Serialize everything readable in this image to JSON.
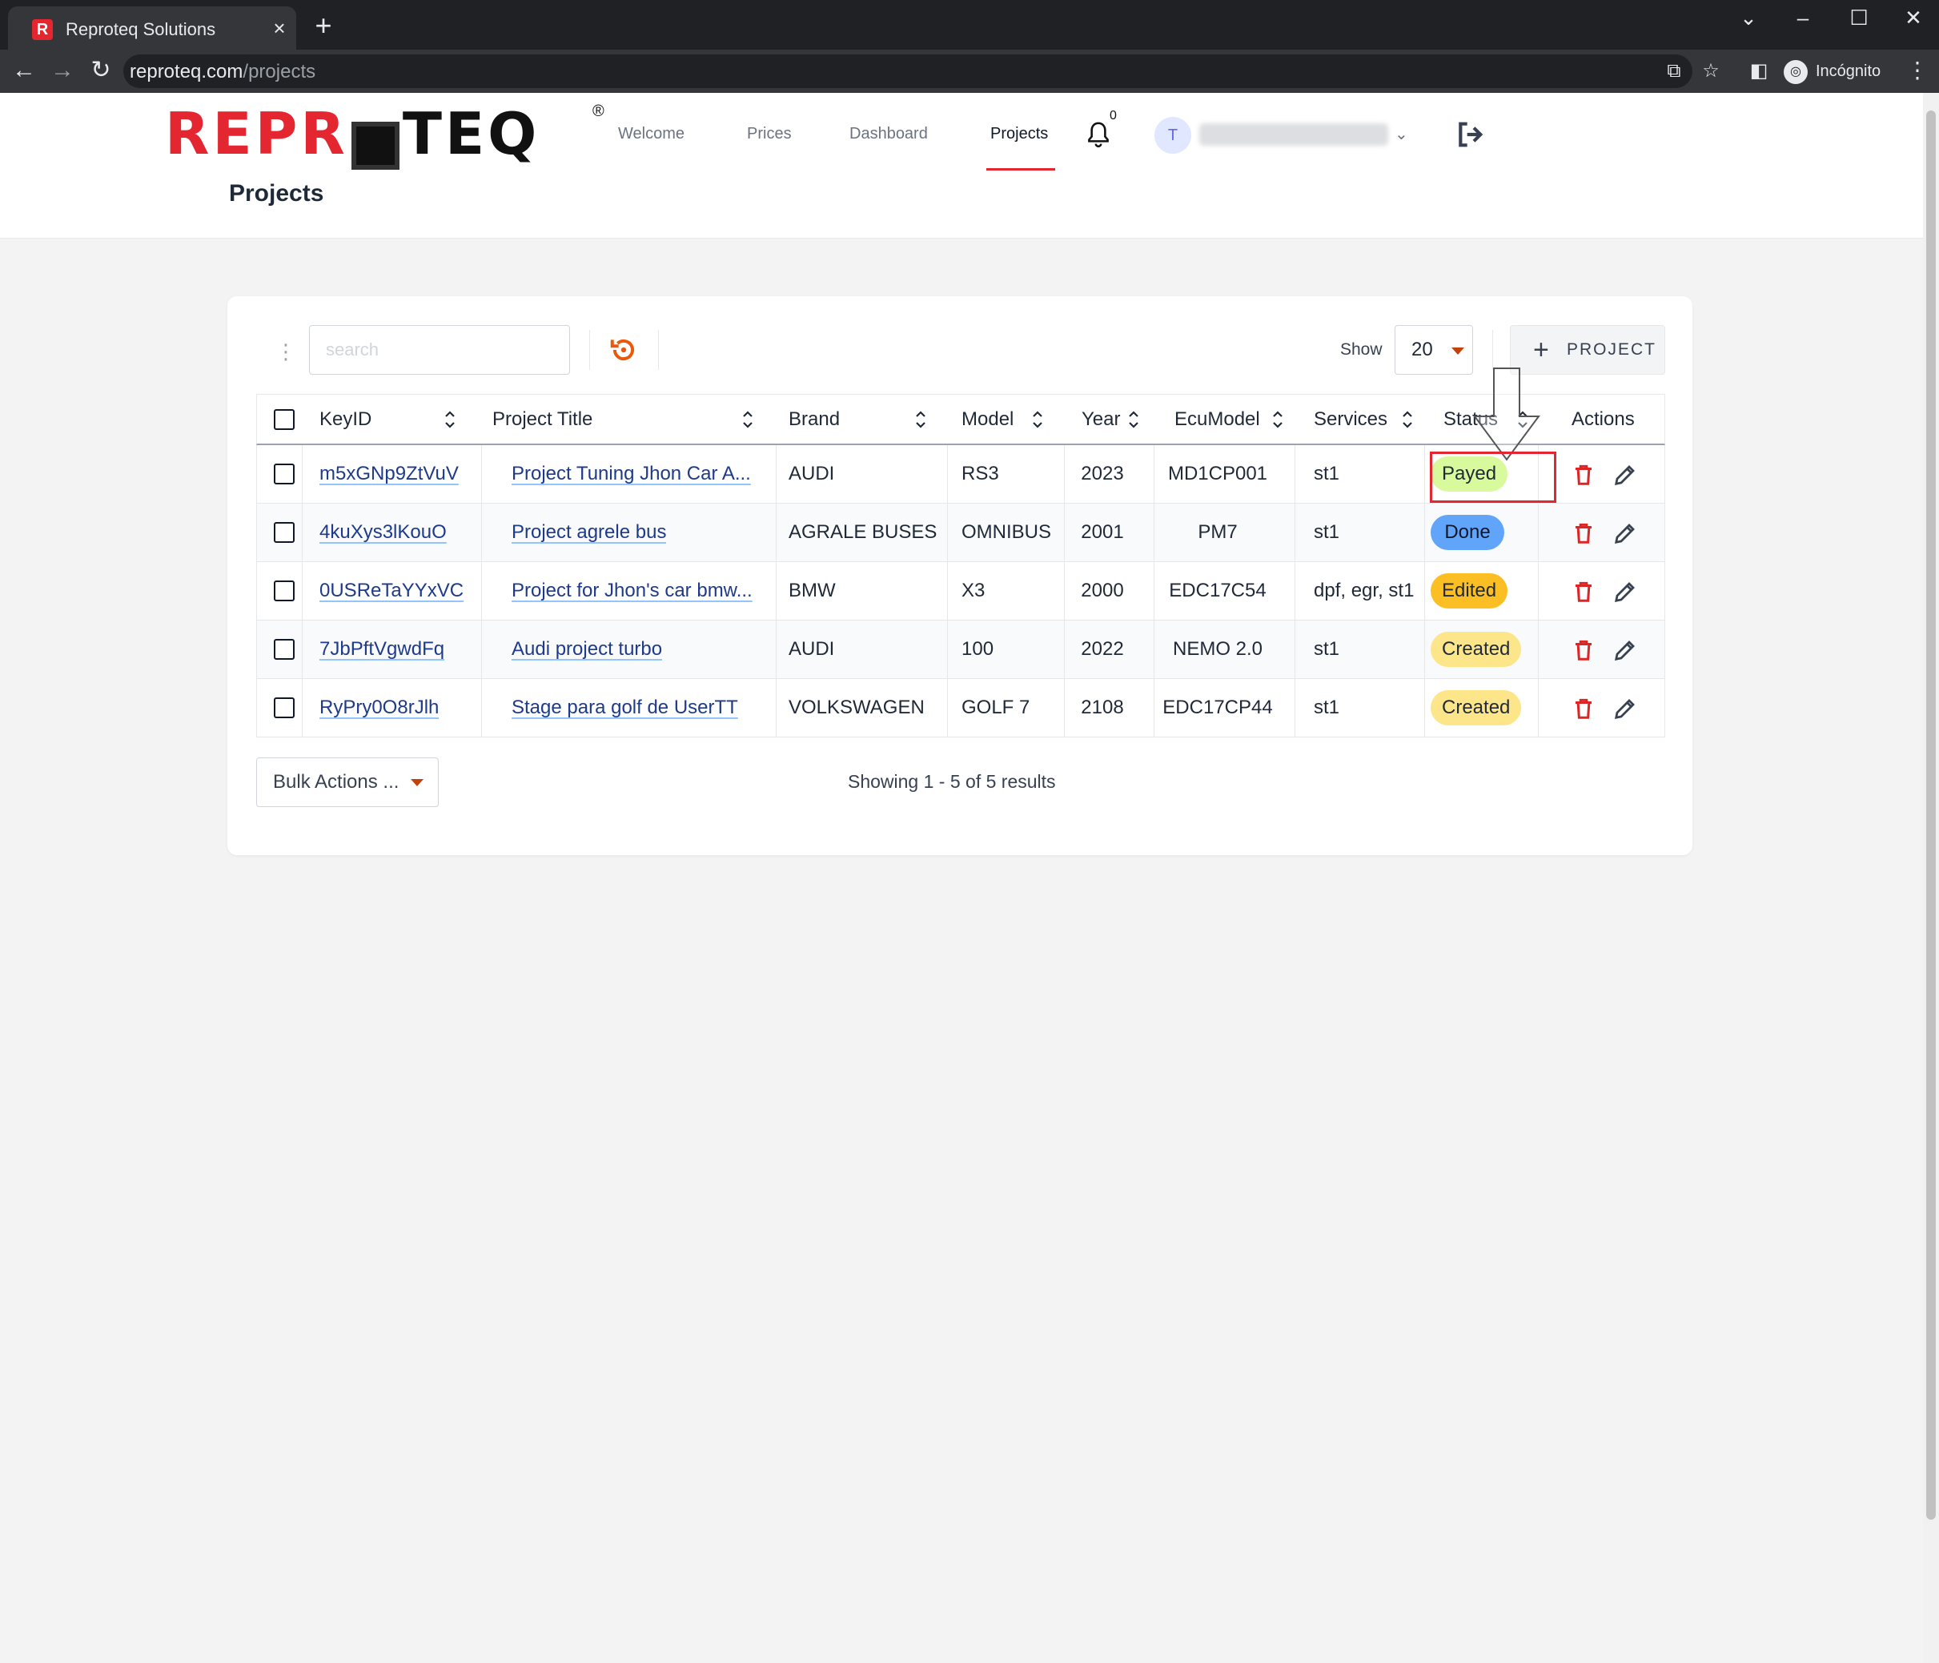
{
  "browser": {
    "tab_title": "Reproteq Solutions",
    "tab_close": "×",
    "new_tab": "+",
    "url_domain": "reproteq.com",
    "url_path": "/projects",
    "incognito_label": "Incógnito"
  },
  "header": {
    "logo_red": "REPR",
    "logo_black": "TEQ",
    "logo_reg": "®",
    "nav": [
      "Welcome",
      "Prices",
      "Dashboard",
      "Projects"
    ],
    "active_nav": "Projects",
    "notification_count": "0",
    "user_initial": "T",
    "page_title": "Projects"
  },
  "toolbar": {
    "search_placeholder": "search",
    "show_label": "Show",
    "page_size": "20",
    "add_label": "PROJECT"
  },
  "table": {
    "columns": [
      "KeyID",
      "Project Title",
      "Brand",
      "Model",
      "Year",
      "EcuModel",
      "Services",
      "Status",
      "Actions"
    ],
    "rows": [
      {
        "key": "m5xGNp9ZtVuV",
        "title": "Project Tuning Jhon Car A...",
        "brand": "AUDI",
        "model": "RS3",
        "year": "2023",
        "ecu": "MD1CP001",
        "services": "st1",
        "status": "Payed"
      },
      {
        "key": "4kuXys3lKouO",
        "title": "Project agrele bus",
        "brand": "AGRALE BUSES",
        "model": "OMNIBUS",
        "year": "2001",
        "ecu": "PM7",
        "services": "st1",
        "status": "Done"
      },
      {
        "key": "0USReTaYYxVC",
        "title": "Project for Jhon's car bmw...",
        "brand": "BMW",
        "model": "X3",
        "year": "2000",
        "ecu": "EDC17C54",
        "services": "dpf, egr, st1",
        "status": "Edited"
      },
      {
        "key": "7JbPftVgwdFq",
        "title": "Audi project turbo",
        "brand": "AUDI",
        "model": "100",
        "year": "2022",
        "ecu": "NEMO 2.0",
        "services": "st1",
        "status": "Created"
      },
      {
        "key": "RyPry0O8rJlh",
        "title": "Stage para golf de UserTT",
        "brand": "VOLKSWAGEN",
        "model": "GOLF 7",
        "year": "2108",
        "ecu": "EDC17CP44",
        "services": "st1",
        "status": "Created"
      }
    ]
  },
  "status_colors": {
    "Payed": "#d9f99d",
    "Done": "#60a5fa",
    "Edited": "#fbbf24",
    "Created": "#fde68a"
  },
  "colors": {
    "brand_red": "#e3262f",
    "action_delete": "#dc2626",
    "action_edit": "#374151"
  },
  "footer": {
    "bulk_label": "Bulk Actions ...",
    "results": "Showing 1 - 5 of 5 results"
  }
}
